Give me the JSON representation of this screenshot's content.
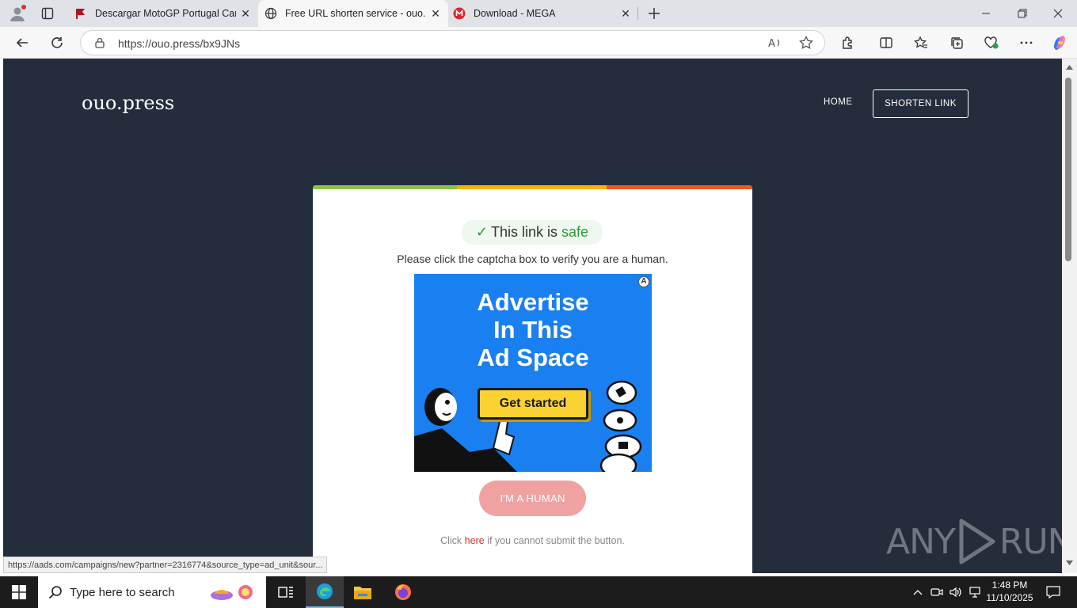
{
  "browser": {
    "tabs": [
      {
        "title": "Descargar MotoGP Portugal Carre",
        "icon": "red-flag-icon"
      },
      {
        "title": "Free URL shorten service - ouo.pr",
        "icon": "globe-icon",
        "active": true
      },
      {
        "title": "Download - MEGA",
        "icon": "mega-icon"
      }
    ],
    "url": "https://ouo.press/bx9JNs",
    "status_url": "https://aads.com/campaigns/new?partner=2316774&source_type=ad_unit&sour..."
  },
  "site": {
    "logo": "ouo.press",
    "nav": {
      "home": "HOME",
      "shorten": "SHORTEN LINK"
    }
  },
  "card": {
    "safe_check": "✓",
    "safe_prefix": "This link is",
    "safe_word": "safe",
    "instruction": "Please click the captcha box to verify you are a human.",
    "ad": {
      "headline_lines": [
        "Advertise",
        "In This",
        "Ad Space"
      ],
      "cta": "Get started",
      "badge": "A"
    },
    "human_button": "I'M A HUMAN",
    "fallback_prefix": "Click",
    "fallback_link": "here",
    "fallback_suffix": "if you cannot submit the button.",
    "bar_colors": [
      "#8cc63f",
      "#f7b500",
      "#ea5b1c"
    ]
  },
  "watermark": {
    "left": "ANY",
    "right": "RUN"
  },
  "taskbar": {
    "search_placeholder": "Type here to search",
    "time": "1:48 PM",
    "date": "11/10/2025"
  }
}
